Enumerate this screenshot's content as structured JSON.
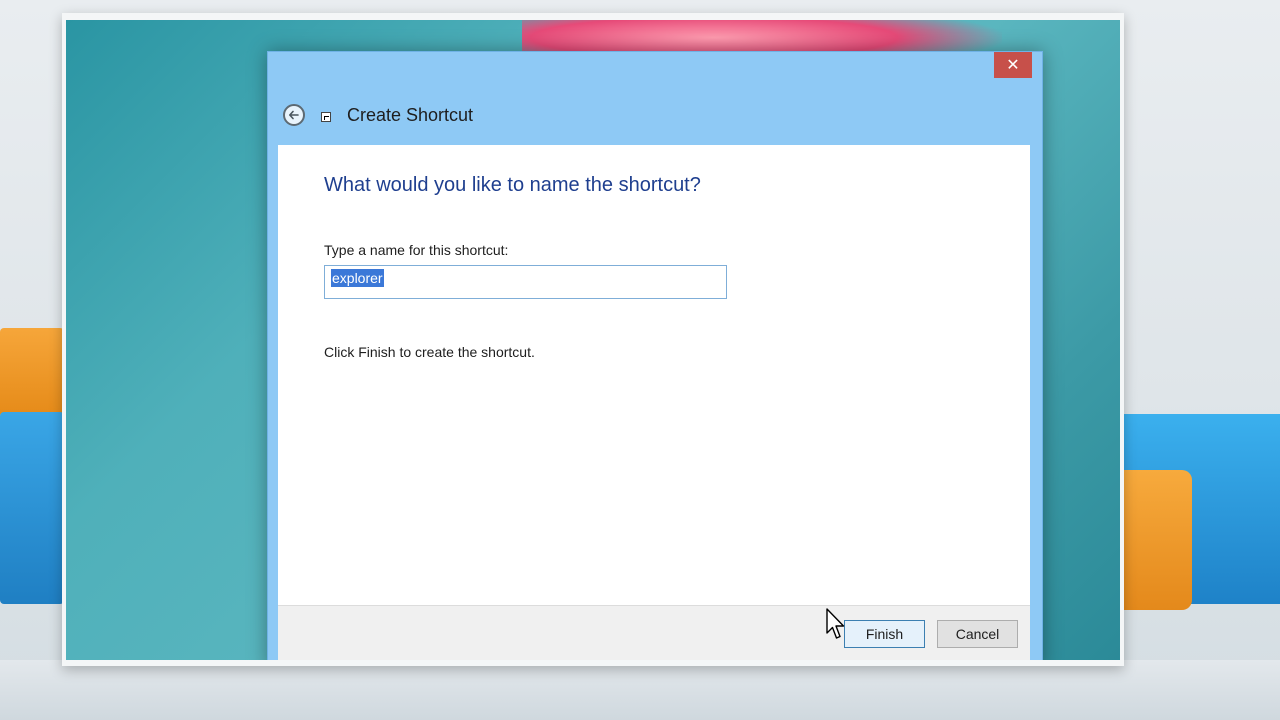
{
  "dialog": {
    "close_glyph": "✕",
    "title": "Create Shortcut",
    "heading": "What would you like to name the shortcut?",
    "name_label": "Type a name for this shortcut:",
    "name_value": "explorer",
    "hint": "Click Finish to create the shortcut.",
    "finish_label": "Finish",
    "cancel_label": "Cancel"
  },
  "icons": {
    "back": "back-arrow-icon",
    "shortcut": "shortcut-icon",
    "close": "close-icon",
    "cursor": "mouse-pointer-icon"
  },
  "colors": {
    "title_bar": "#8ec9f5",
    "heading_text": "#1f3f8f",
    "close_button": "#c7504a",
    "selection": "#3b78d8"
  }
}
